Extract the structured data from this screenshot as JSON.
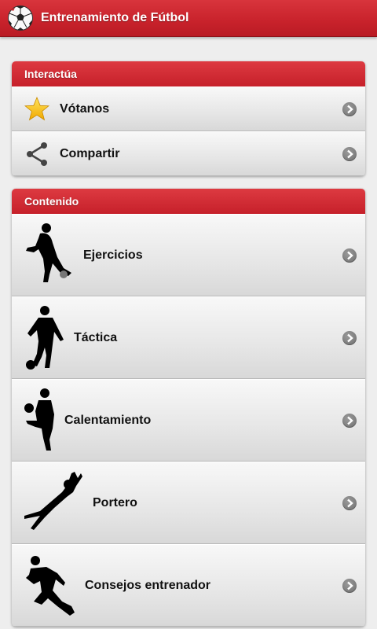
{
  "app": {
    "title": "Entrenamiento de Fútbol"
  },
  "interact": {
    "header": "Interactúa",
    "items": [
      {
        "label": "Vótanos",
        "icon": "star-icon"
      },
      {
        "label": "Compartir",
        "icon": "share-icon"
      }
    ]
  },
  "content": {
    "header": "Contenido",
    "items": [
      {
        "label": "Ejercicios",
        "icon": "player-kicking-icon"
      },
      {
        "label": "Táctica",
        "icon": "player-standing-ball-icon"
      },
      {
        "label": "Calentamiento",
        "icon": "player-juggling-icon"
      },
      {
        "label": "Portero",
        "icon": "goalkeeper-diving-icon"
      },
      {
        "label": "Consejos entrenador",
        "icon": "player-running-icon"
      }
    ]
  },
  "colors": {
    "accent": "#c8222b",
    "header_text": "#ffffff"
  }
}
